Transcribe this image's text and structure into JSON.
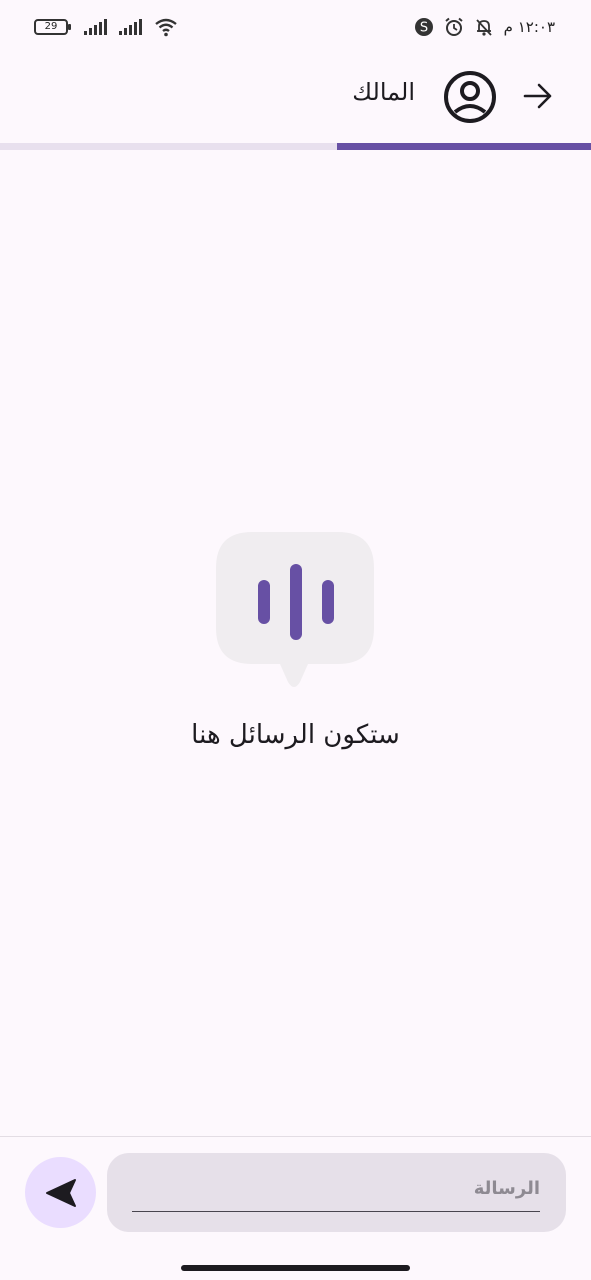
{
  "status_bar": {
    "time": "١٢:٠٣ م",
    "battery_level": "29",
    "icons": [
      "battery-icon",
      "signal-icon",
      "signal-icon",
      "wifi-icon",
      "app-s-icon",
      "alarm-icon",
      "mute-icon"
    ]
  },
  "header": {
    "title": "المالك",
    "avatar_icon": "account-circle-icon",
    "back_icon": "arrow-forward-icon"
  },
  "progress": {
    "fraction": 0.43,
    "track_color": "#e8e0ee",
    "fill_color": "#6750a4"
  },
  "empty_state": {
    "icon": "voice-bubble-icon",
    "message": "ستكون الرسائل هنا"
  },
  "composer": {
    "placeholder": "الرسالة",
    "value": "",
    "send_icon": "send-icon"
  },
  "colors": {
    "accent": "#6750a4",
    "background": "#fdf8fd",
    "field_bg": "#e6e0e9",
    "send_bg": "#eaddff"
  }
}
